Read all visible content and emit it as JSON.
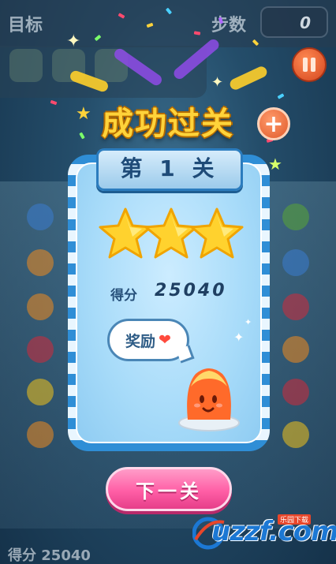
{
  "hud": {
    "goal_label": "目标",
    "moves_label": "步数",
    "moves_value": "0"
  },
  "result": {
    "title": "成功过关",
    "level_text": "第 1 关",
    "stars_earned": 3,
    "stars_total": 3,
    "score_label": "得分",
    "score_value": "25040",
    "reward_label": "奖励",
    "reward_icon": "heart-icon",
    "next_button": "下一关"
  },
  "bottom": {
    "score_text": "得分 25040"
  },
  "watermark": {
    "text": "uzzf.com",
    "sub": "乐园下载"
  },
  "colors": {
    "title": "#ffd33a",
    "panel_stripe": "#2f8ed6",
    "next_button": "#ff5fa6",
    "star": "#ffd22e"
  }
}
